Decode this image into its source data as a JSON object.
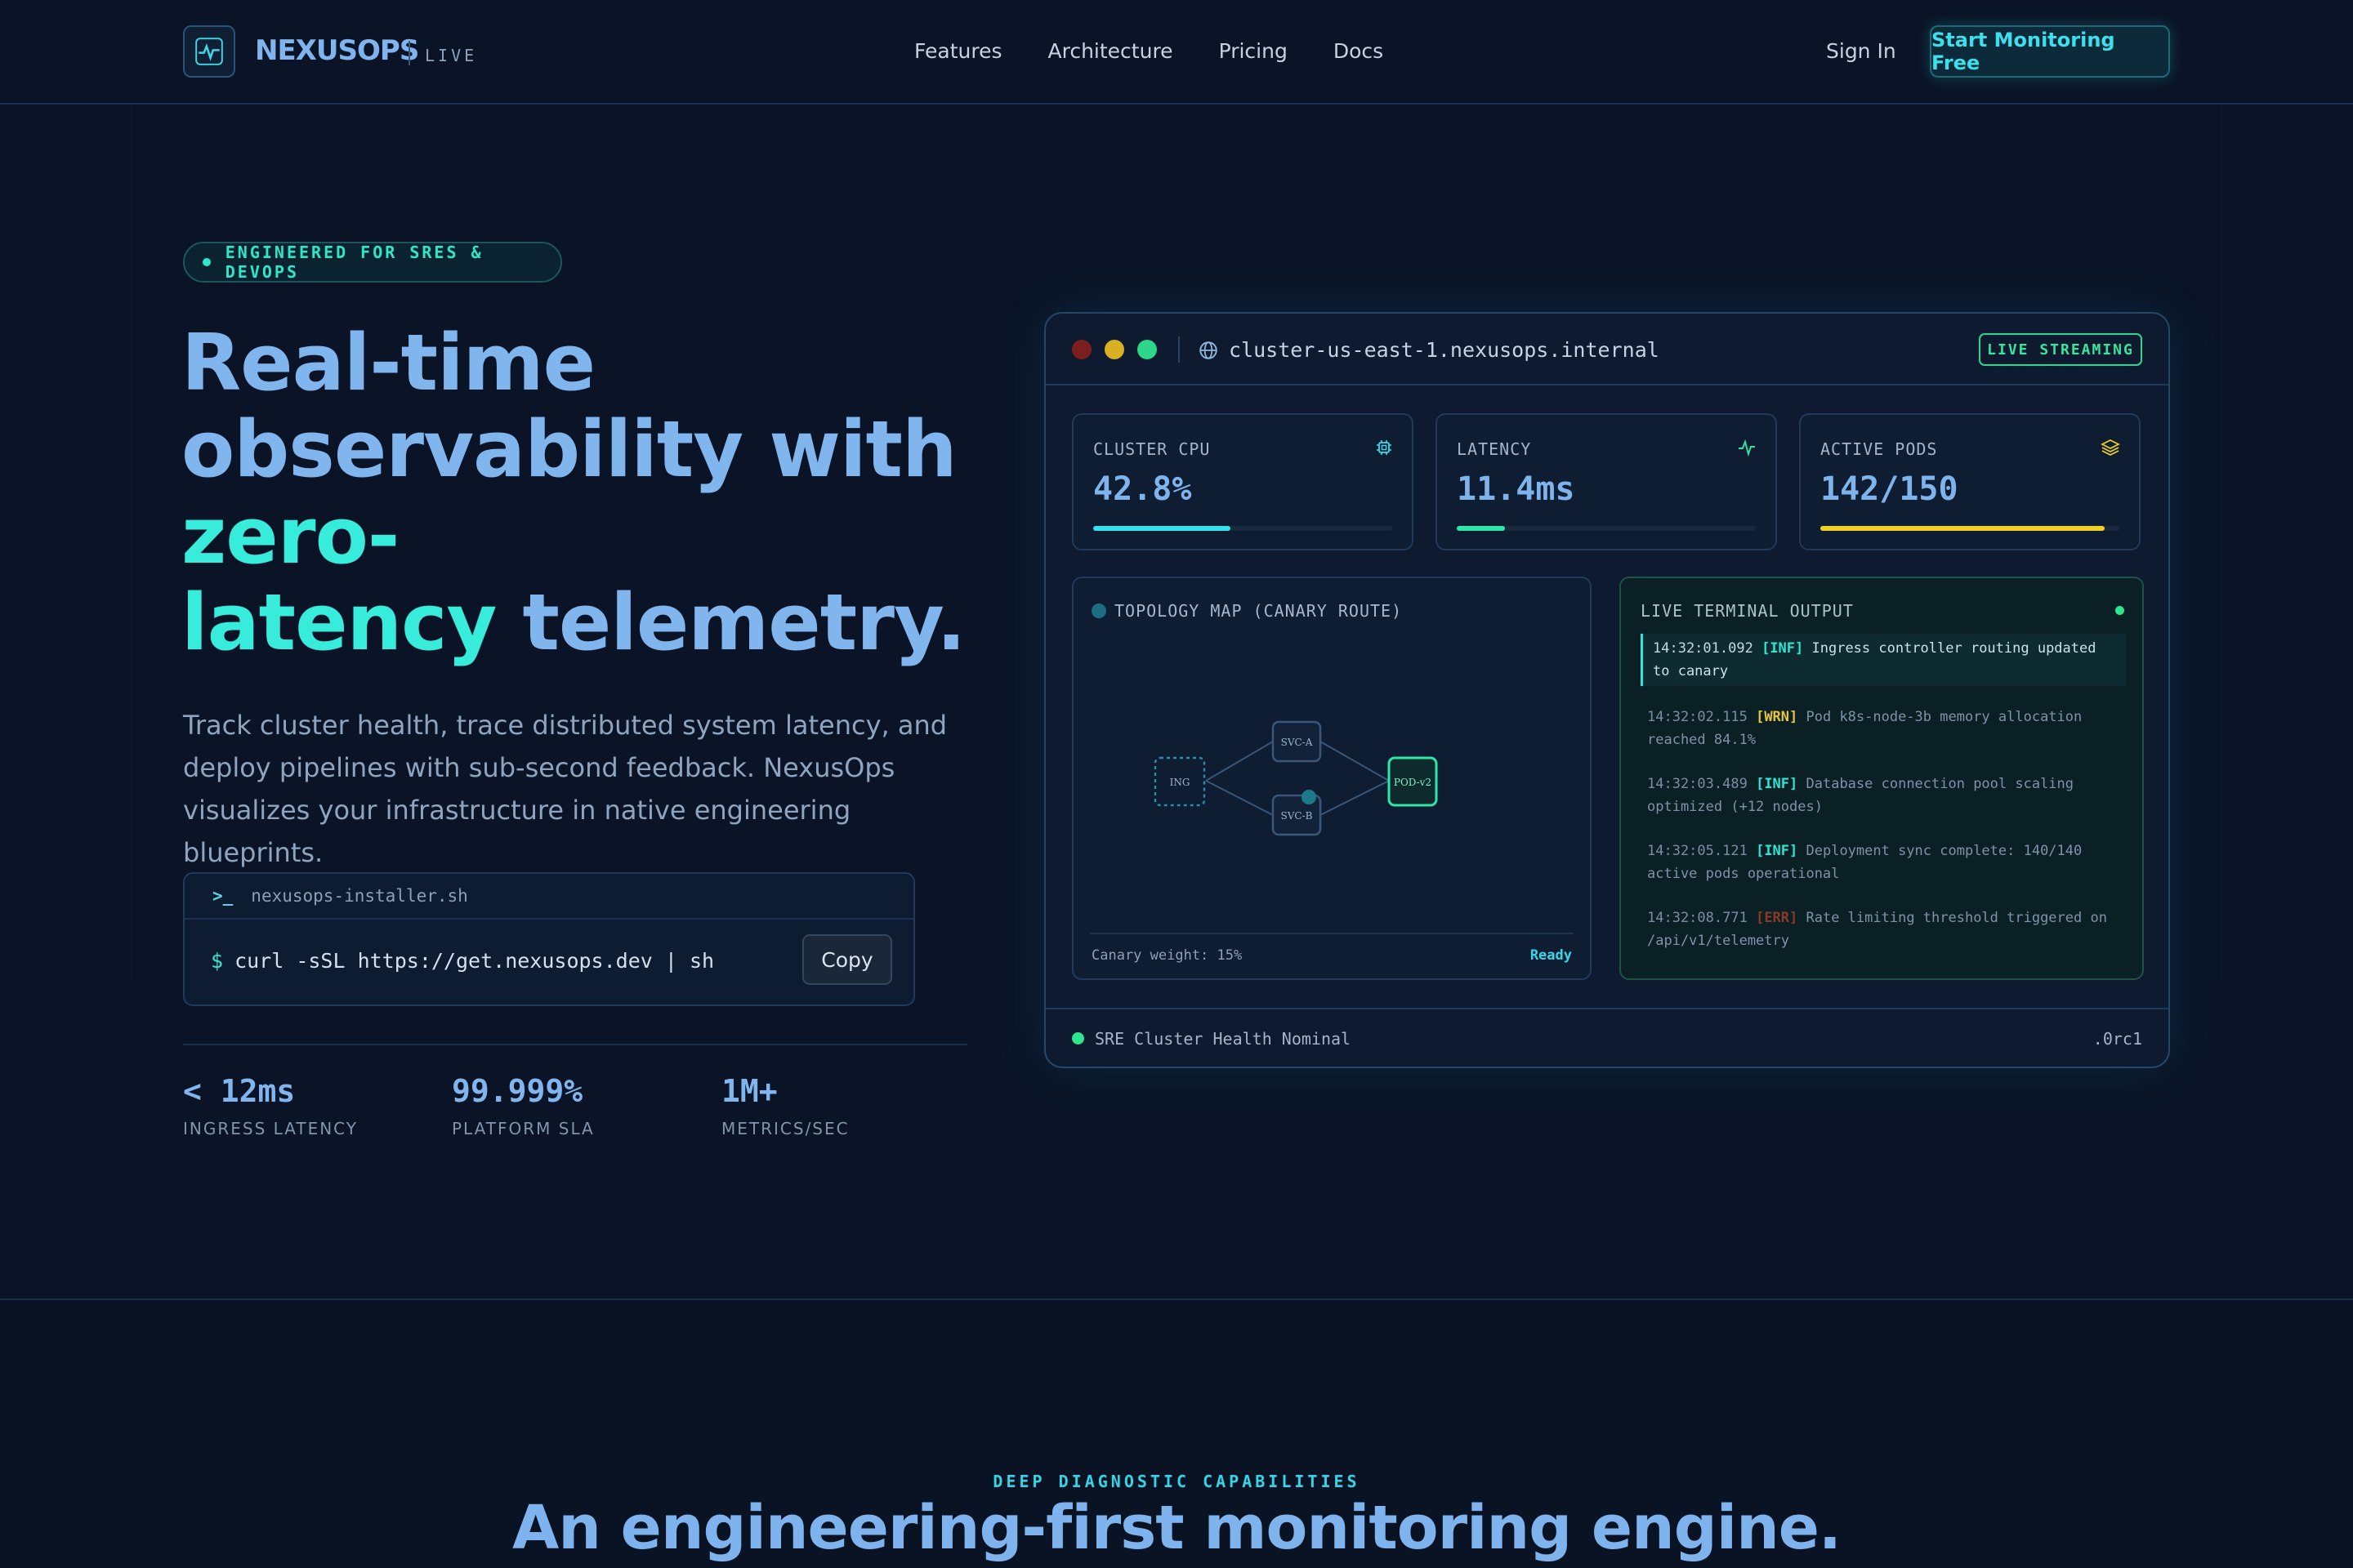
{
  "nav": {
    "brand": "NEXUSOPS",
    "brand_tag": "LIVE",
    "links": [
      "Features",
      "Architecture",
      "Pricing",
      "Docs"
    ],
    "sign_in": "Sign In",
    "cta": "Start Monitoring Free",
    "logo_icon": "pulse-icon"
  },
  "hero": {
    "pill": "ENGINEERED FOR SRES & DEVOPS",
    "headline_a": "Real-time observability with ",
    "headline_accent_a": "zero-",
    "headline_accent_b": "latency",
    "headline_b": " telemetry.",
    "lead": "Track cluster health, trace distributed system latency, and deploy pipelines with sub-second feedback. NexusOps visualizes your infrastructure in native engineering blueprints.",
    "installer": {
      "prompt": ">_",
      "filename": "nexusops-installer.sh",
      "dollar": "$",
      "command": "curl -sSL https://get.nexusops.dev | sh",
      "copy": "Copy"
    },
    "stats": [
      {
        "value": "< 12ms",
        "label": "INGRESS LATENCY"
      },
      {
        "value": "99.999%",
        "label": "PLATFORM SLA"
      },
      {
        "value": "1M+",
        "label": "METRICS/SEC"
      }
    ]
  },
  "dashboard": {
    "url": "cluster-us-east-1.nexusops.internal",
    "badge": "LIVE STREAMING",
    "colors": {
      "red": "#7a1e1e",
      "yellow": "#d9b024",
      "green": "#2ed68a"
    },
    "metrics": [
      {
        "label": "CLUSTER CPU",
        "value": "42.8%",
        "icon": "cpu-icon",
        "fill": 0.46,
        "color": "#33e2ee"
      },
      {
        "label": "LATENCY",
        "value": "11.4ms",
        "icon": "activity-icon",
        "fill": 0.16,
        "color": "#2ee6a8"
      },
      {
        "label": "ACTIVE PODS",
        "value": "142/150",
        "icon": "layers-icon",
        "fill": 0.95,
        "color": "#f0d023"
      }
    ],
    "topology": {
      "title": "TOPOLOGY MAP (CANARY ROUTE)",
      "nodes": [
        "ING",
        "SVC-A",
        "SVC-B",
        "POD-v2"
      ],
      "canary": "Canary weight: 15%",
      "status": "Ready"
    },
    "terminal": {
      "title": "LIVE TERMINAL OUTPUT",
      "logs": [
        {
          "ts": "14:32:01.092",
          "level": "[INF]",
          "msg": " Ingress controller routing updated to canary",
          "kind": "inf",
          "active": true
        },
        {
          "ts": "14:32:02.115",
          "level": "[WRN]",
          "msg": " Pod k8s-node-3b memory allocation reached 84.1%",
          "kind": "wrn",
          "active": false
        },
        {
          "ts": "14:32:03.489",
          "level": "[INF]",
          "msg": " Database connection pool scaling optimized (+12 nodes)",
          "kind": "inf",
          "active": false
        },
        {
          "ts": "14:32:05.121",
          "level": "[INF]",
          "msg": " Deployment sync complete: 140/140 active pods operational",
          "kind": "inf",
          "active": false
        },
        {
          "ts": "14:32:08.771",
          "level": "[ERR]",
          "msg": " Rate limiting threshold triggered on /api/v1/telemetry",
          "kind": "err",
          "active": false
        }
      ]
    },
    "footer": {
      "status": "SRE Cluster Health Nominal",
      "version": ".0rc1"
    }
  },
  "section2": {
    "eyebrow": "DEEP DIAGNOSTIC CAPABILITIES",
    "title": "An engineering-first monitoring engine."
  }
}
